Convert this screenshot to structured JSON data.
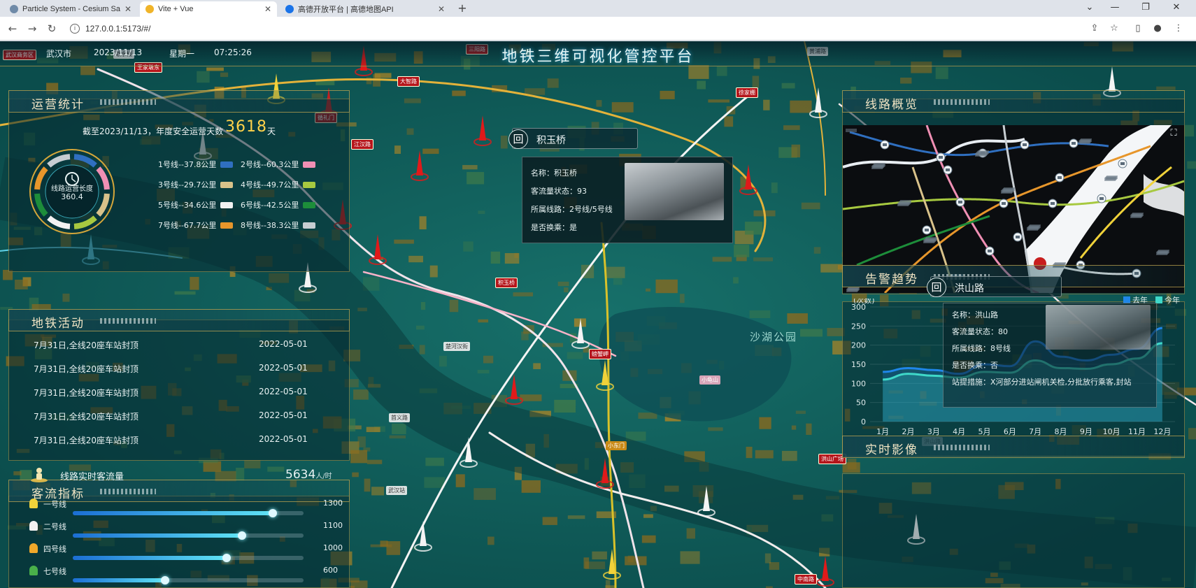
{
  "browser": {
    "tabs": [
      {
        "label": "Particle System - Cesium Sandc",
        "active": false,
        "icon_color": "#6f8aa8"
      },
      {
        "label": "Vite + Vue",
        "active": true,
        "icon_color": "#f0b429"
      },
      {
        "label": "高德开放平台 | 高德地图API",
        "active": false,
        "icon_color": "#1a73e8"
      }
    ],
    "url": "127.0.0.1:5173/#/",
    "icons": [
      "back-arrow-icon",
      "forward-arrow-icon",
      "reload-icon",
      "site-info-icon",
      "share-icon",
      "star-icon",
      "sidebar-icon",
      "profile-icon",
      "menu-icon"
    ]
  },
  "header": {
    "city": "武汉市",
    "date": "2023/11/13",
    "week": "星期一",
    "time": "07:25:26",
    "title": "地铁三维可视化管控平台"
  },
  "operations": {
    "title": "运营统计",
    "summary_prefix": "截至2023/11/13，年度安全运营天数",
    "days": "3618",
    "days_unit": "天",
    "ring_label": "线路运营长度",
    "ring_value": "360.4",
    "lines": [
      {
        "label": "1号线--37.8公里",
        "color": "#2f6fc0"
      },
      {
        "label": "2号线--60.3公里",
        "color": "#f08fb4"
      },
      {
        "label": "3号线--29.7公里",
        "color": "#d9c28a"
      },
      {
        "label": "4号线--49.7公里",
        "color": "#a7c940"
      },
      {
        "label": "5号线--34.6公里",
        "color": "#f2f2f2"
      },
      {
        "label": "6号线--42.5公里",
        "color": "#1d8d3a"
      },
      {
        "label": "7号线--67.7公里",
        "color": "#e7962b"
      },
      {
        "label": "8号线--38.3公里",
        "color": "#c7cdd2"
      }
    ]
  },
  "activity": {
    "title": "地铁活动",
    "items": [
      {
        "event": "7月31日,全线20座车站封顶",
        "date": "2022-05-01"
      },
      {
        "event": "7月31日,全线20座车站封顶",
        "date": "2022-05-01"
      },
      {
        "event": "7月31日,全线20座车站封顶",
        "date": "2022-05-01"
      },
      {
        "event": "7月31日,全线20座车站封顶",
        "date": "2022-05-01"
      },
      {
        "event": "7月31日,全线20座车站封顶",
        "date": "2022-05-01"
      }
    ]
  },
  "passenger": {
    "title": "客流指标",
    "realtime_label": "线路实时客流量",
    "total": "5634",
    "total_unit": "人/时",
    "max": 1500,
    "rows": [
      {
        "label": "一号线",
        "value": 1300,
        "color": "#f0d23a"
      },
      {
        "label": "二号线",
        "value": 1100,
        "color": "#f2f2f2"
      },
      {
        "label": "四号线",
        "value": 1000,
        "color": "#f0a82a"
      },
      {
        "label": "七号线",
        "value": 600,
        "color": "#49b04a"
      }
    ]
  },
  "overview": {
    "title": "线路概览",
    "fullscreen_icon": "fullscreen-icon"
  },
  "alarm": {
    "title": "告警趋势",
    "ylabel": "(次数)",
    "legend": [
      {
        "name": "去年",
        "color": "#1f86e8"
      },
      {
        "name": "今年",
        "color": "#3fd8c8"
      }
    ]
  },
  "video": {
    "title": "实时影像"
  },
  "popup_main": {
    "station": "积玉桥",
    "name_label": "名称：",
    "name_value": "积玉桥",
    "status_label": "客流量状态：",
    "status_value": "93",
    "line_label": "所属线路：",
    "line_value": "2号线/5号线",
    "transfer_label": "是否换乘：",
    "transfer_value": "是"
  },
  "popup_second": {
    "station": "洪山路",
    "name_label": "名称：",
    "name_value": "洪山路",
    "status_label": "客流量状态：",
    "status_value": "80",
    "line_label": "所属线路：",
    "line_value": "8号线",
    "transfer_label": "是否换乘：",
    "transfer_value": "否",
    "note_label": "站提措施：",
    "note_value": "X河部分进站闸机关检,分批放行乘客,封站"
  },
  "map": {
    "lake": "沙湖公园",
    "labels": [
      {
        "text": "武汉商务区",
        "style": "red"
      },
      {
        "text": "王家墩东",
        "style": "red"
      },
      {
        "text": "取水楼",
        "style": "wh"
      },
      {
        "text": "三阳路",
        "style": "red"
      },
      {
        "text": "黄浦路",
        "style": "wh"
      },
      {
        "text": "大智路",
        "style": "red"
      },
      {
        "text": "徐家棚",
        "style": "red"
      },
      {
        "text": "循礼门",
        "style": "red"
      },
      {
        "text": "江汉路",
        "style": "red"
      },
      {
        "text": "积玉桥",
        "style": "red"
      },
      {
        "text": "小东门",
        "style": "yel"
      },
      {
        "text": "楚河汉街",
        "style": "wh"
      },
      {
        "text": "螃蟹岬",
        "style": "red"
      },
      {
        "text": "首义路",
        "style": "wh"
      },
      {
        "text": "小龟山",
        "style": "pink"
      },
      {
        "text": "洪山广场",
        "style": "red"
      },
      {
        "text": "洪山路",
        "style": "wh"
      },
      {
        "text": "中南路",
        "style": "red"
      },
      {
        "text": "武汉站",
        "style": "wh"
      }
    ]
  },
  "chart_data": {
    "type": "area",
    "title": "告警趋势",
    "ylabel": "(次数)",
    "xlabel": "",
    "categories": [
      "1月",
      "2月",
      "3月",
      "4月",
      "5月",
      "6月",
      "7月",
      "8月",
      "9月",
      "10月",
      "11月",
      "12月"
    ],
    "ylim": [
      0,
      300
    ],
    "yticks": [
      0,
      50,
      100,
      150,
      200,
      250,
      300
    ],
    "legend_position": "top-right",
    "series": [
      {
        "name": "去年",
        "values": [
          130,
          140,
          135,
          125,
          150,
          145,
          210,
          170,
          160,
          175,
          190,
          245
        ],
        "color": "#1f86e8"
      },
      {
        "name": "今年",
        "values": [
          110,
          125,
          120,
          115,
          130,
          128,
          160,
          140,
          138,
          150,
          165,
          205
        ],
        "color": "#3fd8c8"
      }
    ]
  }
}
